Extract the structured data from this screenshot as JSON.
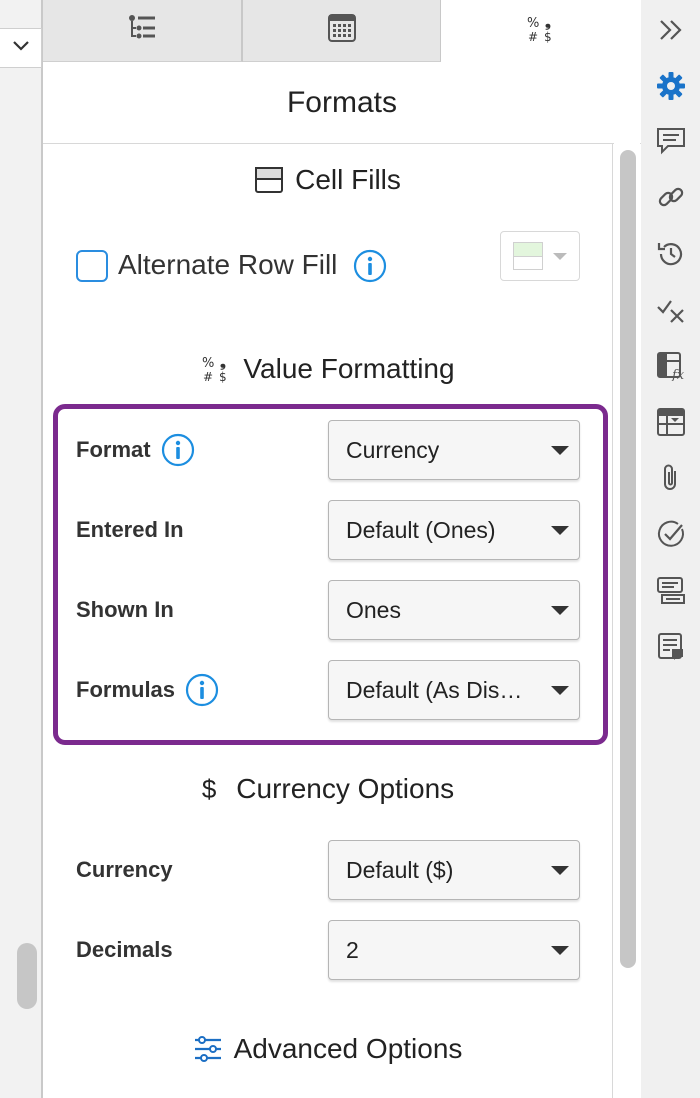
{
  "tabs": [
    {
      "name": "structure",
      "icon": "list-tree-icon"
    },
    {
      "name": "grid",
      "icon": "grid-icon"
    },
    {
      "name": "formats",
      "icon": "value-format-icon",
      "active": true
    }
  ],
  "header": {
    "title": "Formats"
  },
  "cell_fills": {
    "title": "Cell Fills",
    "alternate_row_fill_label": "Alternate Row Fill",
    "alternate_row_fill_checked": false,
    "fill_color": "#e3f6dd"
  },
  "value_formatting": {
    "title": "Value Formatting",
    "rows": [
      {
        "label": "Format",
        "value": "Currency",
        "info": true
      },
      {
        "label": "Entered In",
        "value": "Default (Ones)",
        "info": false
      },
      {
        "label": "Shown In",
        "value": "Ones",
        "info": false
      },
      {
        "label": "Formulas",
        "value": "Default (As Disp…",
        "info": true
      }
    ]
  },
  "currency_options": {
    "title": "Currency Options",
    "symbol": "$",
    "rows": [
      {
        "label": "Currency",
        "value": "Default ($)"
      },
      {
        "label": "Decimals",
        "value": "2"
      }
    ]
  },
  "advanced_options": {
    "title": "Advanced Options"
  },
  "value_format_glyph": {
    "top_left": "%",
    "top_right": "❟",
    "bottom_left": "#",
    "bottom_right": "$"
  },
  "rail": {
    "icons": [
      "expand-chevrons-icon",
      "gear-icon",
      "comment-icon",
      "link-icon",
      "history-icon",
      "check-x-icon",
      "formula-table-icon",
      "table-dropdown-icon",
      "attachment-icon",
      "check-circle-icon",
      "comments-list-icon",
      "note-icon"
    ]
  },
  "colors": {
    "accent": "#1c8ee0",
    "highlight": "#7b2a8e",
    "gear": "#1a73c9"
  }
}
